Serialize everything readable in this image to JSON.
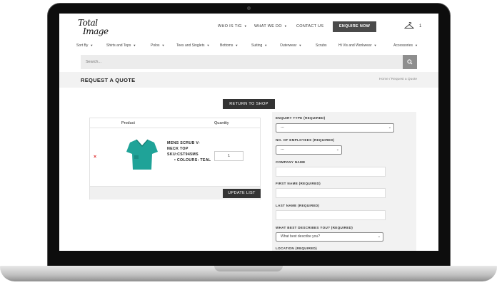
{
  "header": {
    "logo_line1": "Total",
    "logo_line2": "Image",
    "nav": [
      "WHO IS TIG",
      "WHAT WE DO",
      "CONTACT US"
    ],
    "enquire_label": "ENQUIRE NOW",
    "cart_count": "1"
  },
  "categories": [
    "Sort By",
    "Shirts and Tops",
    "Polos",
    "Tees and Singlets",
    "Bottoms",
    "Suiting",
    "Outerwear",
    "Scrubs",
    "Hi Vis and Workwear",
    "Accessories"
  ],
  "search": {
    "placeholder": "Search..."
  },
  "page": {
    "title": "REQUEST A QUOTE",
    "breadcrumb": "Home / Request a Quote"
  },
  "return_label": "RETURN TO SHOP",
  "cart": {
    "col_product": "Product",
    "col_quantity": "Quantity",
    "remove_symbol": "×",
    "item": {
      "name": "MENS SCRUB V-NECK TOP SKU:CST945MS",
      "attribute": "• COLOURS: TEAL",
      "quantity": "1"
    },
    "update_label": "UPDATE LIST"
  },
  "form": {
    "enquiry_type_label": "ENQUIRY TYPE (REQUIRED)",
    "enquiry_type_value": "---",
    "employees_label": "NO. OF EMPLOYEES (REQUIRED)",
    "employees_value": "---",
    "company_label": "COMPANY NAME",
    "first_name_label": "FIRST NAME (REQUIRED)",
    "last_name_label": "LAST NAME (REQUIRED)",
    "describes_label": "WHAT BEST DESCRIBES YOU? (REQUIRED)",
    "describes_value": "What best describe you?",
    "location_label": "LOCATION (REQUIRED)"
  },
  "colors": {
    "teal": "#1fa398",
    "dark_button": "#4a4a4a",
    "remove_red": "#dd2222"
  }
}
